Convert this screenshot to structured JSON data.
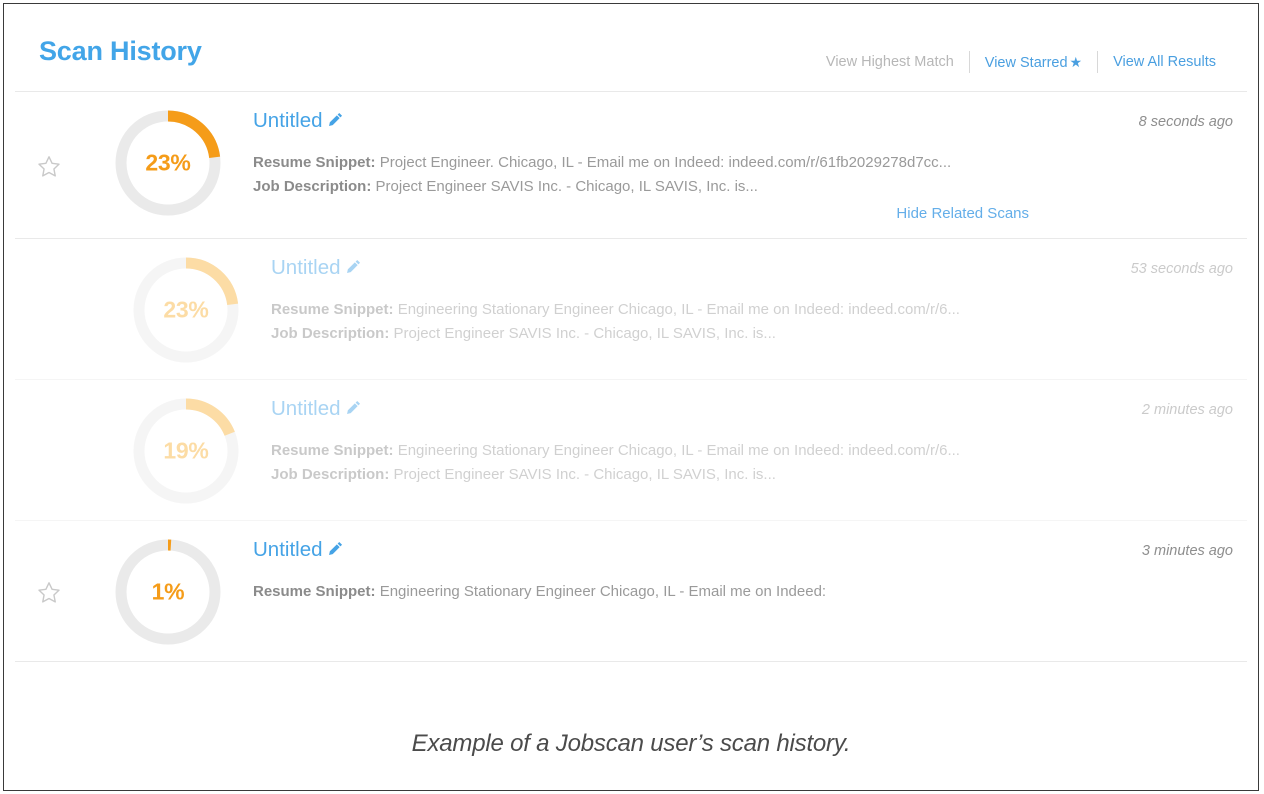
{
  "header": {
    "title": "Scan History",
    "nav": [
      {
        "label": "View Highest Match",
        "muted": true,
        "star": false
      },
      {
        "label": "View Starred",
        "muted": false,
        "star": true
      },
      {
        "label": "View All Results",
        "muted": false,
        "star": false
      }
    ],
    "star_glyph": "★"
  },
  "colors": {
    "brand_blue": "#42a5e8",
    "link_blue": "#4a9fe0",
    "score_orange": "#f59c19",
    "score_orange_faded": "#f9b43c",
    "track_grey": "#eaeaea",
    "muted_text": "#9a9a9a"
  },
  "rows": [
    {
      "starred": false,
      "related": false,
      "score": 23,
      "score_label": "23%",
      "title": "Untitled",
      "resume_label": "Resume Snippet:",
      "resume_text": "Project Engineer. Chicago, IL - Email me on Indeed: indeed.com/r/61fb2029278d7cc...",
      "job_label": "Job Description:",
      "job_text": "Project Engineer SAVIS Inc. - Chicago, IL SAVIS, Inc. is...",
      "related_toggle": "Hide Related Scans",
      "time": "8 seconds ago"
    },
    {
      "starred": false,
      "related": true,
      "score": 23,
      "score_label": "23%",
      "title": "Untitled",
      "resume_label": "Resume Snippet:",
      "resume_text": "Engineering Stationary Engineer Chicago, IL - Email me on Indeed: indeed.com/r/6...",
      "job_label": "Job Description:",
      "job_text": "Project Engineer SAVIS Inc. - Chicago, IL SAVIS, Inc. is...",
      "related_toggle": "",
      "time": "53 seconds ago"
    },
    {
      "starred": false,
      "related": true,
      "score": 19,
      "score_label": "19%",
      "title": "Untitled",
      "resume_label": "Resume Snippet:",
      "resume_text": "Engineering Stationary Engineer Chicago, IL - Email me on Indeed: indeed.com/r/6...",
      "job_label": "Job Description:",
      "job_text": "Project Engineer SAVIS Inc. - Chicago, IL SAVIS, Inc. is...",
      "related_toggle": "",
      "time": "2 minutes ago"
    },
    {
      "starred": false,
      "related": false,
      "score": 1,
      "score_label": "1%",
      "title": "Untitled",
      "resume_label": "Resume Snippet:",
      "resume_text": "Engineering Stationary Engineer Chicago, IL - Email me on Indeed:",
      "job_label": "",
      "job_text": "",
      "related_toggle": "",
      "time": "3 minutes ago"
    }
  ],
  "caption": "Example of a Jobscan user’s scan history."
}
